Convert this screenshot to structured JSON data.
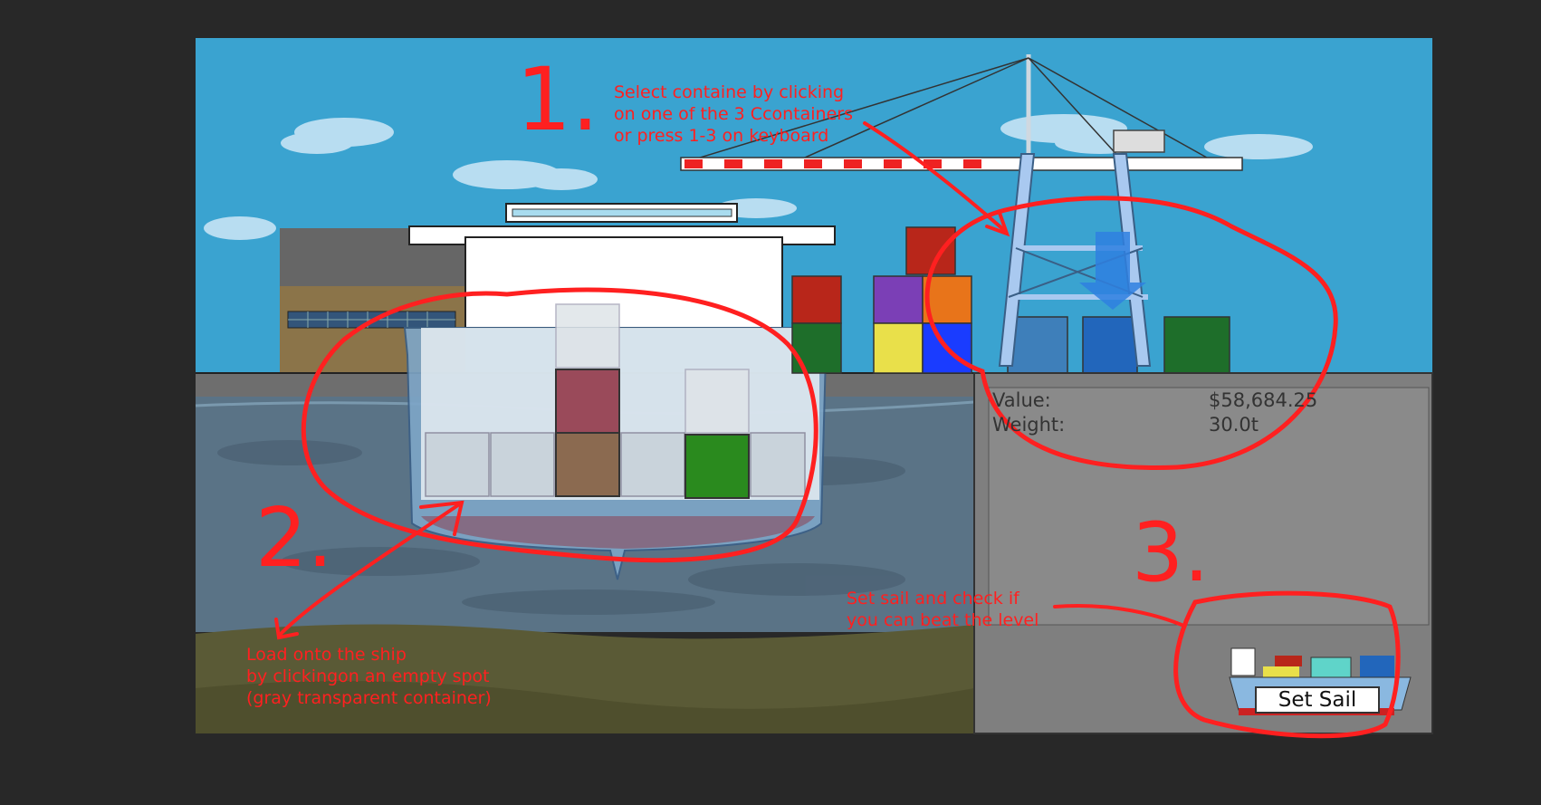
{
  "hud": {
    "value_label": "Value:",
    "value": "$58,684.25",
    "weight_label": "Weight:",
    "weight": "30.0t"
  },
  "controls": {
    "set_sail_label": "Set Sail"
  },
  "annotations": {
    "step1_number": "1.",
    "step1_text": "Select containe by clicking\non one of the 3 Ccontainers\nor press 1-3 on keyboard",
    "step2_number": "2.",
    "step2_text": "Load onto the ship\nby clickingon an empty spot\n(gray transparent container)",
    "step3_number": "3.",
    "step3_text": "Set sail and check if\nyou can beat the level"
  },
  "colors": {
    "sky": "#3aa3d0",
    "water": "#5a7386",
    "dock": "#6e6e6e",
    "panel": "#7f7f7f",
    "annotation": "#ff2020",
    "crane": "#a9c9f0"
  },
  "selectable_containers": [
    {
      "slot": 1,
      "color": "#3e7fba"
    },
    {
      "slot": 2,
      "color": "#2266bb"
    },
    {
      "slot": 3,
      "color": "#1e6e2a"
    }
  ],
  "ship_slots": [
    {
      "state": "empty"
    },
    {
      "state": "empty"
    },
    {
      "state": "filled",
      "color": "#9a4a5a"
    },
    {
      "state": "empty"
    },
    {
      "state": "filled",
      "color": "#8b6a50"
    },
    {
      "state": "filled",
      "color": "#2a8a1e"
    }
  ]
}
